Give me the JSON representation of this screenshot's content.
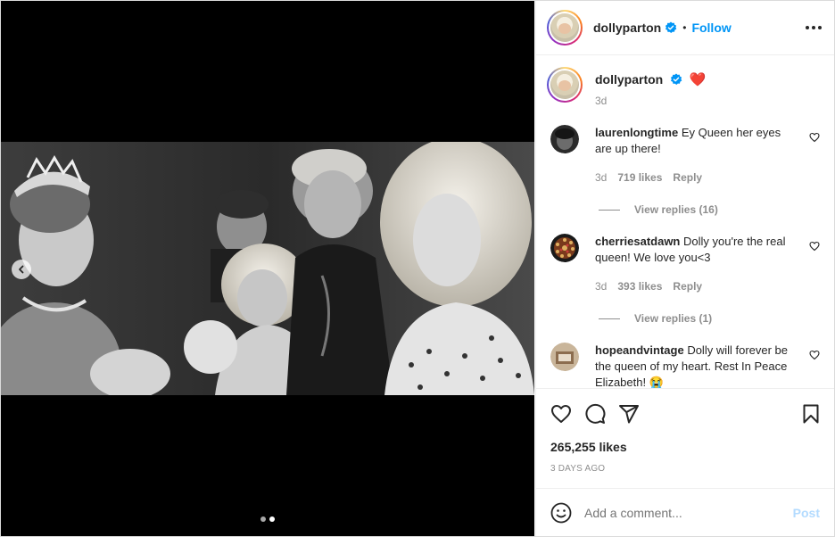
{
  "post": {
    "author": "dollyparton",
    "follow_label": "Follow",
    "bullet": "•",
    "caption_emoji": "❤️",
    "caption_time": "3d",
    "likes_text": "265,255 likes",
    "time_ago": "3 DAYS AGO",
    "carousel": {
      "total": 2,
      "active_index": 1
    }
  },
  "comments": [
    {
      "user": "laurenlongtime",
      "text": "Ey Queen her eyes are up there!",
      "time": "3d",
      "likes": "719 likes",
      "reply_label": "Reply",
      "view_replies": "View replies (16)",
      "avatar_color": "#3a3a3a"
    },
    {
      "user": "cherriesatdawn",
      "text": "Dolly you're the real queen! We love you<3",
      "time": "3d",
      "likes": "393 likes",
      "reply_label": "Reply",
      "view_replies": "View replies (1)",
      "avatar_color": "#5a2d1a"
    },
    {
      "user": "hopeandvintage",
      "text": "Dolly will forever be the queen of my heart. Rest In Peace Elizabeth! 😭",
      "avatar_color": "#b79a7a"
    }
  ],
  "composer": {
    "placeholder": "Add a comment...",
    "post_label": "Post"
  },
  "colors": {
    "accent": "#0095f6",
    "heart": "#ed4956",
    "post_disabled": "#b3dbff"
  }
}
